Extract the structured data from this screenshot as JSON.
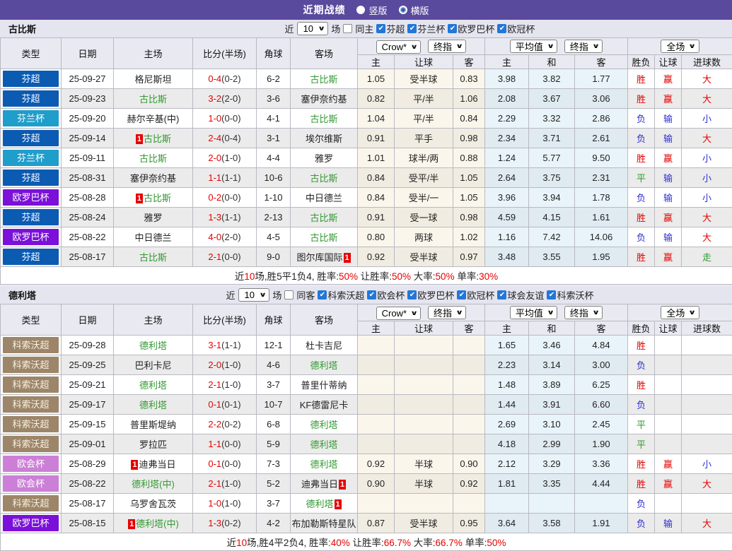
{
  "title_bar": {
    "title": "近期战绩",
    "radio_vertical": "竖版",
    "radio_horizontal": "横版"
  },
  "colors": {
    "title_bar_bg": "#5a4a9d",
    "panel_bg": "#e5e5f0",
    "grid_border": "#b9b9c2",
    "win_red": "#e60000",
    "lose_blue": "#2f2fd0",
    "draw_green": "#2e9b2e",
    "main_team_green": "#339933",
    "crown_col_bg": "#fbf6ec",
    "avg_col_bg": "#e9f4fa",
    "checkbox_blue": "#2277d8"
  },
  "league_colors": {
    "芬超": [
      "#0b5bb2",
      "#ffffff"
    ],
    "芬兰杯": [
      "#1f9dcb",
      "#ffffff"
    ],
    "欧罗巴杯": [
      "#7b10d8",
      "#ffffff"
    ],
    "科索沃超": [
      "#9d8569",
      "#f7f2e2"
    ],
    "欧会杯": [
      "#cc7fd6",
      "#ffffff"
    ]
  },
  "table_header": {
    "main_cols": [
      "类型",
      "日期",
      "主场",
      "比分(半场)",
      "角球",
      "客场"
    ],
    "selects": {
      "crow": "Crow*",
      "final": "终指",
      "avg": "平均值",
      "full": "全场"
    },
    "sub_cols": [
      "主",
      "让球",
      "客",
      "主",
      "和",
      "客",
      "胜负",
      "让球",
      "进球数"
    ]
  },
  "sections": [
    {
      "team": "古比斯",
      "filter": {
        "near": "近",
        "count": "10",
        "games": "场",
        "same": "同主",
        "same_checked": false,
        "leagues": [
          "芬超",
          "芬兰杯",
          "欧罗巴杯",
          "欧冠杯"
        ]
      },
      "rows": [
        {
          "league": "芬超",
          "date": "25-09-27",
          "home": {
            "name": "格尼斯坦"
          },
          "score": [
            "0-4",
            "(0-2)"
          ],
          "corner": "6-2",
          "away": {
            "name": "古比斯",
            "main": true
          },
          "odds": [
            "1.05",
            "受半球",
            "0.83"
          ],
          "avg": [
            "3.98",
            "3.82",
            "1.77"
          ],
          "res": [
            [
              "胜",
              "r"
            ],
            [
              "赢",
              "r"
            ],
            [
              "大",
              "r"
            ]
          ]
        },
        {
          "league": "芬超",
          "date": "25-09-23",
          "home": {
            "name": "古比斯",
            "main": true
          },
          "score": [
            "3-2",
            "(2-0)"
          ],
          "corner": "3-6",
          "away": {
            "name": "塞伊奈约基"
          },
          "odds": [
            "0.82",
            "平/半",
            "1.06"
          ],
          "avg": [
            "2.08",
            "3.67",
            "3.06"
          ],
          "res": [
            [
              "胜",
              "r"
            ],
            [
              "赢",
              "r"
            ],
            [
              "大",
              "r"
            ]
          ]
        },
        {
          "league": "芬兰杯",
          "date": "25-09-20",
          "home": {
            "name": "赫尔辛基(中)"
          },
          "score": [
            "1-0",
            "(0-0)"
          ],
          "corner": "4-1",
          "away": {
            "name": "古比斯",
            "main": true
          },
          "odds": [
            "1.04",
            "平/半",
            "0.84"
          ],
          "avg": [
            "2.29",
            "3.32",
            "2.86"
          ],
          "res": [
            [
              "负",
              "b"
            ],
            [
              "输",
              "b"
            ],
            [
              "小",
              "b"
            ]
          ]
        },
        {
          "league": "芬超",
          "date": "25-09-14",
          "home": {
            "name": "古比斯",
            "main": true,
            "card_pre": true
          },
          "score": [
            "2-4",
            "(0-4)"
          ],
          "corner": "3-1",
          "away": {
            "name": "埃尔维斯"
          },
          "odds": [
            "0.91",
            "平手",
            "0.98"
          ],
          "avg": [
            "2.34",
            "3.71",
            "2.61"
          ],
          "res": [
            [
              "负",
              "b"
            ],
            [
              "输",
              "b"
            ],
            [
              "大",
              "r"
            ]
          ]
        },
        {
          "league": "芬兰杯",
          "date": "25-09-11",
          "home": {
            "name": "古比斯",
            "main": true
          },
          "score": [
            "2-0",
            "(1-0)"
          ],
          "corner": "4-4",
          "away": {
            "name": "雅罗"
          },
          "odds": [
            "1.01",
            "球半/两",
            "0.88"
          ],
          "avg": [
            "1.24",
            "5.77",
            "9.50"
          ],
          "res": [
            [
              "胜",
              "r"
            ],
            [
              "赢",
              "r"
            ],
            [
              "小",
              "b"
            ]
          ]
        },
        {
          "league": "芬超",
          "date": "25-08-31",
          "home": {
            "name": "塞伊奈约基"
          },
          "score": [
            "1-1",
            "(1-1)"
          ],
          "corner": "10-6",
          "away": {
            "name": "古比斯",
            "main": true
          },
          "odds": [
            "0.84",
            "受平/半",
            "1.05"
          ],
          "avg": [
            "2.64",
            "3.75",
            "2.31"
          ],
          "res": [
            [
              "平",
              "g"
            ],
            [
              "输",
              "b"
            ],
            [
              "小",
              "b"
            ]
          ]
        },
        {
          "league": "欧罗巴杯",
          "date": "25-08-28",
          "home": {
            "name": "古比斯",
            "main": true,
            "card_pre": true
          },
          "score": [
            "0-2",
            "(0-0)"
          ],
          "corner": "1-10",
          "away": {
            "name": "中日德兰"
          },
          "odds": [
            "0.84",
            "受半/一",
            "1.05"
          ],
          "avg": [
            "3.96",
            "3.94",
            "1.78"
          ],
          "res": [
            [
              "负",
              "b"
            ],
            [
              "输",
              "b"
            ],
            [
              "小",
              "b"
            ]
          ]
        },
        {
          "league": "芬超",
          "date": "25-08-24",
          "home": {
            "name": "雅罗"
          },
          "score": [
            "1-3",
            "(1-1)"
          ],
          "corner": "2-13",
          "away": {
            "name": "古比斯",
            "main": true
          },
          "odds": [
            "0.91",
            "受一球",
            "0.98"
          ],
          "avg": [
            "4.59",
            "4.15",
            "1.61"
          ],
          "res": [
            [
              "胜",
              "r"
            ],
            [
              "赢",
              "r"
            ],
            [
              "大",
              "r"
            ]
          ]
        },
        {
          "league": "欧罗巴杯",
          "date": "25-08-22",
          "home": {
            "name": "中日德兰"
          },
          "score": [
            "4-0",
            "(2-0)"
          ],
          "corner": "4-5",
          "away": {
            "name": "古比斯",
            "main": true
          },
          "odds": [
            "0.80",
            "两球",
            "1.02"
          ],
          "avg": [
            "1.16",
            "7.42",
            "14.06"
          ],
          "res": [
            [
              "负",
              "b"
            ],
            [
              "输",
              "b"
            ],
            [
              "大",
              "r"
            ]
          ]
        },
        {
          "league": "芬超",
          "date": "25-08-17",
          "home": {
            "name": "古比斯",
            "main": true
          },
          "score": [
            "2-1",
            "(0-0)"
          ],
          "corner": "9-0",
          "away": {
            "name": "图尔库国际",
            "card_post": true
          },
          "odds": [
            "0.92",
            "受半球",
            "0.97"
          ],
          "avg": [
            "3.48",
            "3.55",
            "1.95"
          ],
          "res": [
            [
              "胜",
              "r"
            ],
            [
              "赢",
              "r"
            ],
            [
              "走",
              "g"
            ]
          ]
        }
      ],
      "summary": [
        [
          "近",
          "k"
        ],
        [
          "10",
          "r"
        ],
        [
          "场,胜5平1负4, 胜率:",
          "k"
        ],
        [
          "50%",
          "r"
        ],
        [
          " 让胜率:",
          "k"
        ],
        [
          "50%",
          "r"
        ],
        [
          " 大率:",
          "k"
        ],
        [
          "50%",
          "r"
        ],
        [
          " 单率:",
          "k"
        ],
        [
          "30%",
          "r"
        ]
      ]
    },
    {
      "team": "德利塔",
      "filter": {
        "near": "近",
        "count": "10",
        "games": "场",
        "same": "同客",
        "same_checked": false,
        "leagues": [
          "科索沃超",
          "欧会杯",
          "欧罗巴杯",
          "欧冠杯",
          "球会友谊",
          "科索沃杯"
        ]
      },
      "rows": [
        {
          "league": "科索沃超",
          "date": "25-09-28",
          "home": {
            "name": "德利塔",
            "main": true
          },
          "score": [
            "3-1",
            "(1-1)"
          ],
          "corner": "12-1",
          "away": {
            "name": "杜卡吉尼"
          },
          "odds": [
            "",
            "",
            ""
          ],
          "avg": [
            "1.65",
            "3.46",
            "4.84"
          ],
          "res": [
            [
              "胜",
              "r"
            ],
            null,
            null
          ]
        },
        {
          "league": "科索沃超",
          "date": "25-09-25",
          "home": {
            "name": "巴利卡尼"
          },
          "score": [
            "2-0",
            "(1-0)"
          ],
          "corner": "4-6",
          "away": {
            "name": "德利塔",
            "main": true
          },
          "odds": [
            "",
            "",
            ""
          ],
          "avg": [
            "2.23",
            "3.14",
            "3.00"
          ],
          "res": [
            [
              "负",
              "b"
            ],
            null,
            null
          ]
        },
        {
          "league": "科索沃超",
          "date": "25-09-21",
          "home": {
            "name": "德利塔",
            "main": true
          },
          "score": [
            "2-1",
            "(1-0)"
          ],
          "corner": "3-7",
          "away": {
            "name": "普里什蒂纳"
          },
          "odds": [
            "",
            "",
            ""
          ],
          "avg": [
            "1.48",
            "3.89",
            "6.25"
          ],
          "res": [
            [
              "胜",
              "r"
            ],
            null,
            null
          ]
        },
        {
          "league": "科索沃超",
          "date": "25-09-17",
          "home": {
            "name": "德利塔",
            "main": true
          },
          "score": [
            "0-1",
            "(0-1)"
          ],
          "corner": "10-7",
          "away": {
            "name": "KF德雷尼卡"
          },
          "odds": [
            "",
            "",
            ""
          ],
          "avg": [
            "1.44",
            "3.91",
            "6.60"
          ],
          "res": [
            [
              "负",
              "b"
            ],
            null,
            null
          ]
        },
        {
          "league": "科索沃超",
          "date": "25-09-15",
          "home": {
            "name": "普里斯堤纳"
          },
          "score": [
            "2-2",
            "(0-2)"
          ],
          "corner": "6-8",
          "away": {
            "name": "德利塔",
            "main": true
          },
          "odds": [
            "",
            "",
            ""
          ],
          "avg": [
            "2.69",
            "3.10",
            "2.45"
          ],
          "res": [
            [
              "平",
              "g"
            ],
            null,
            null
          ]
        },
        {
          "league": "科索沃超",
          "date": "25-09-01",
          "home": {
            "name": "罗拉匹"
          },
          "score": [
            "1-1",
            "(0-0)"
          ],
          "corner": "5-9",
          "away": {
            "name": "德利塔",
            "main": true
          },
          "odds": [
            "",
            "",
            ""
          ],
          "avg": [
            "4.18",
            "2.99",
            "1.90"
          ],
          "res": [
            [
              "平",
              "g"
            ],
            null,
            null
          ]
        },
        {
          "league": "欧会杯",
          "date": "25-08-29",
          "home": {
            "name": "迪弗当日",
            "card_pre": true
          },
          "score": [
            "0-1",
            "(0-0)"
          ],
          "corner": "7-3",
          "away": {
            "name": "德利塔",
            "main": true
          },
          "odds": [
            "0.92",
            "半球",
            "0.90"
          ],
          "avg": [
            "2.12",
            "3.29",
            "3.36"
          ],
          "res": [
            [
              "胜",
              "r"
            ],
            [
              "赢",
              "r"
            ],
            [
              "小",
              "b"
            ]
          ]
        },
        {
          "league": "欧会杯",
          "date": "25-08-22",
          "home": {
            "name": "德利塔(中)",
            "main": true
          },
          "score": [
            "2-1",
            "(1-0)"
          ],
          "corner": "5-2",
          "away": {
            "name": "迪弗当日",
            "card_post": true
          },
          "odds": [
            "0.90",
            "半球",
            "0.92"
          ],
          "avg": [
            "1.81",
            "3.35",
            "4.44"
          ],
          "res": [
            [
              "胜",
              "r"
            ],
            [
              "赢",
              "r"
            ],
            [
              "大",
              "r"
            ]
          ]
        },
        {
          "league": "科索沃超",
          "date": "25-08-17",
          "home": {
            "name": "乌罗舍瓦茨"
          },
          "score": [
            "1-0",
            "(1-0)"
          ],
          "corner": "3-7",
          "away": {
            "name": "德利塔",
            "main": true,
            "card_post": true
          },
          "odds": [
            "",
            "",
            ""
          ],
          "avg": [
            "",
            "",
            ""
          ],
          "res": [
            [
              "负",
              "b"
            ],
            null,
            null
          ]
        },
        {
          "league": "欧罗巴杯",
          "date": "25-08-15",
          "home": {
            "name": "德利塔(中)",
            "main": true,
            "card_pre": true
          },
          "score": [
            "1-3",
            "(0-2)"
          ],
          "corner": "4-2",
          "away": {
            "name": "布加勒斯特星队"
          },
          "odds": [
            "0.87",
            "受半球",
            "0.95"
          ],
          "avg": [
            "3.64",
            "3.58",
            "1.91"
          ],
          "res": [
            [
              "负",
              "b"
            ],
            [
              "输",
              "b"
            ],
            [
              "大",
              "r"
            ]
          ]
        }
      ],
      "summary": [
        [
          "近",
          "k"
        ],
        [
          "10",
          "r"
        ],
        [
          "场,胜4平2负4, 胜率:",
          "k"
        ],
        [
          "40%",
          "r"
        ],
        [
          " 让胜率:",
          "k"
        ],
        [
          "66.7%",
          "r"
        ],
        [
          " 大率:",
          "k"
        ],
        [
          "66.7%",
          "r"
        ],
        [
          " 单率:",
          "k"
        ],
        [
          "50%",
          "r"
        ]
      ]
    }
  ]
}
